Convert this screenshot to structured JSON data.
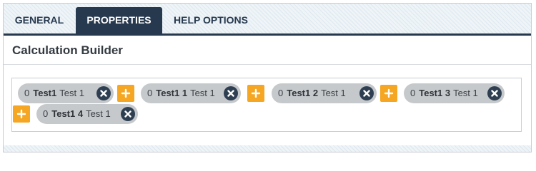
{
  "tabs": {
    "general": "GENERAL",
    "properties": "PROPERTIES",
    "help": "HELP OPTIONS",
    "active": "PROPERTIES"
  },
  "builder": {
    "title": "Calculation Builder",
    "tokens": [
      {
        "operator": "0",
        "name": "Test1",
        "description": "Test 1"
      },
      {
        "operator": "0",
        "name": "Test1 1",
        "description": "Test 1"
      },
      {
        "operator": "0",
        "name": "Test1 2",
        "description": "Test 1"
      },
      {
        "operator": "0",
        "name": "Test1 3",
        "description": "Test 1"
      },
      {
        "operator": "0",
        "name": "Test1 4",
        "description": "Test 1"
      }
    ],
    "add_button_symbol": "+",
    "remove_icon": "close-circle-icon"
  },
  "colors": {
    "accent": "#f5a623",
    "navy": "#27394f",
    "token_bg": "#c6c9cc"
  }
}
